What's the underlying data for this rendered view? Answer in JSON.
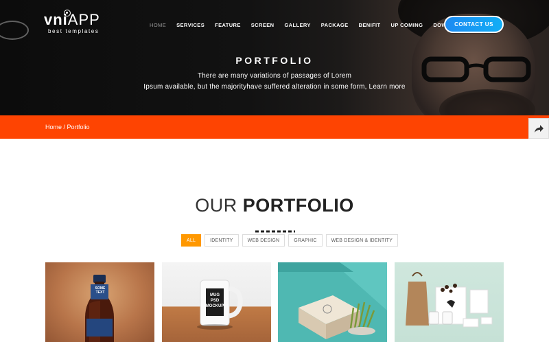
{
  "brand": {
    "name_bold": "vni",
    "name_thin": "APP",
    "tagline": "best templates"
  },
  "nav": [
    "HOME",
    "SERVICES",
    "FEATURE",
    "SCREEN",
    "GALLERY",
    "PACKAGE",
    "BENIFIT",
    "UP COMING",
    "DOWNLOAD APP"
  ],
  "nav_active": "HOME",
  "contact_button": "CONTACT US",
  "hero": {
    "title": "PORTFOLIO",
    "subtitle_line1": "There are many variations of passages of Lorem",
    "subtitle_line2": "Ipsum available, but the majorityhave suffered alteration in some form, Learn more"
  },
  "breadcrumb": {
    "home": "Home",
    "separator": " / ",
    "current": "Portfolio"
  },
  "share_icon": "share-arrow-icon",
  "portfolio": {
    "title_light": "OUR",
    "title_bold": "PORTFOLIO",
    "filters": [
      "ALL",
      "IDENTITY",
      "WEB DESIGN",
      "GRAPHIC",
      "WEB DESIGN & IDENTITY"
    ],
    "active_filter": "ALL",
    "items": [
      {
        "label_line1": "SOME",
        "label_line2": "TEXT"
      },
      {
        "label_line1": "MUG",
        "label_line2": "PSD",
        "label_line3": "MOCKUP"
      },
      {
        "label_line1": ""
      },
      {
        "label_line1": ""
      }
    ]
  },
  "colors": {
    "accent_orange": "#fe4402",
    "filter_active": "#ff9800",
    "contact_blue": "#1c8af2"
  }
}
